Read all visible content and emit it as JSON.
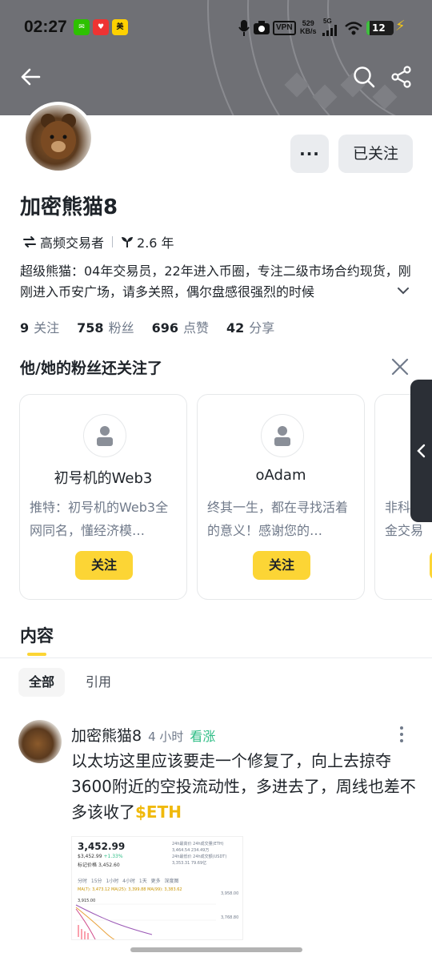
{
  "statusbar": {
    "time": "02:27",
    "net_speed_top": "529",
    "net_speed_bottom": "KB/s",
    "network": "5G",
    "vpn": "VPN",
    "battery": "12"
  },
  "header": {
    "back_icon": "arrow-left-icon",
    "search_icon": "search-icon",
    "share_icon": "share-icon"
  },
  "profile": {
    "name": "加密熊猫8",
    "more_label": "···",
    "follow_state_label": "已关注",
    "tag_trader": "高频交易者",
    "tag_years": "2.6 年",
    "bio": "超级熊猫：04年交易员，22年进入币圈，专注二级市场合约现货，刚刚进入币安广场，请多关照，偶尔盘感很强烈的时候",
    "stats": [
      {
        "value": "9",
        "label": "关注"
      },
      {
        "value": "758",
        "label": "粉丝"
      },
      {
        "value": "696",
        "label": "点赞"
      },
      {
        "value": "42",
        "label": "分享"
      }
    ]
  },
  "suggestions": {
    "title": "他/她的粉丝还关注了",
    "cards": [
      {
        "name": "初号机的Web3",
        "desc": "推特：初号机的Web3全网同名，懂经济模…",
        "button": "关注"
      },
      {
        "name": "oAdam",
        "desc": "终其一生，都在寻找活着的意义！感谢您的…",
        "button": "关注"
      },
      {
        "name": "",
        "desc": "非科资金交易",
        "button": "关注"
      }
    ]
  },
  "content": {
    "section_tab": "内容",
    "filters": [
      "全部",
      "引用"
    ]
  },
  "post": {
    "author": "加密熊猫8",
    "time": "4 小时",
    "sentiment": "看涨",
    "text": "以太坊这里应该要走一个修复了，向上去掠夺3600附近的空投流动性，多进去了，周线也差不多该收了",
    "coin_tag": "$ETH",
    "chart_image": {
      "price": "3,452.99",
      "sub_price": "$3,452.99",
      "change": "+1.33%",
      "mark_label": "标记价格",
      "mark_price": "3,452.60",
      "high_label": "24h最高价",
      "high": "3,464.54",
      "low_label": "24h最低价",
      "low": "3,353.31",
      "vol_eth_label": "24h成交量(ETH)",
      "vol_eth": "234.49万",
      "vol_usdt_label": "24h成交额(USDT)",
      "vol_usdt": "79.69亿",
      "intervals": "分时 15分 1小时 4小时 1天 更多 深度图",
      "ma_line": "MA(7): 3,473.12  MA(25): 3,399.88  MA(99): 3,383.62",
      "axis_top": "3,958.00",
      "axis_mid": "3,768.80",
      "marker": "3,915.00"
    }
  },
  "colors": {
    "brand_yellow": "#FCD535",
    "bullish_green": "#2EBD85",
    "coin_tag": "#F0B90B",
    "banner": "#6F7075"
  }
}
